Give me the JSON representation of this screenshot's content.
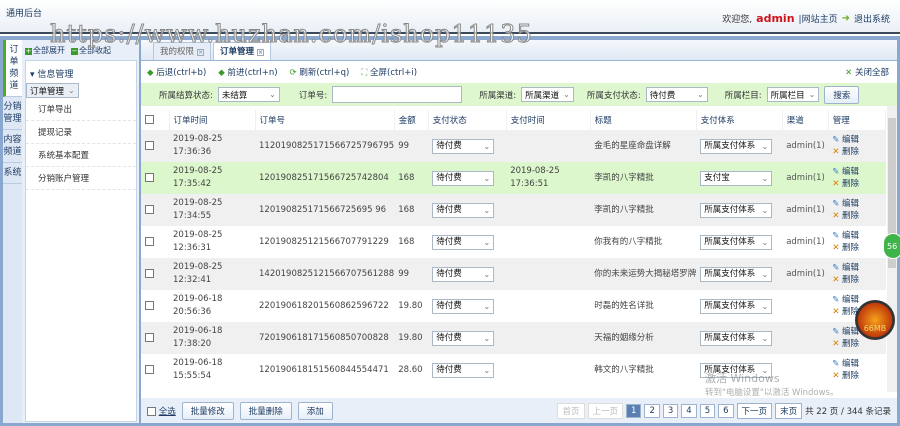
{
  "header": {
    "title": "通用后台",
    "welcome": "欢迎您,",
    "user": "admin",
    "site_home": "|网站主页",
    "logout": "退出系统"
  },
  "vtabs": [
    "订单频道",
    "分销管理",
    "内容频道",
    "系统"
  ],
  "left": {
    "expand_all": "全部展开",
    "collapse_all": "全部收起",
    "group": "信息管理",
    "items": [
      "订单管理",
      "订单导出",
      "提现记录",
      "系统基本配置",
      "分销账户管理"
    ]
  },
  "tabs": [
    "我的权限",
    "订单管理"
  ],
  "toolbar": {
    "back": "后退(ctrl+b)",
    "forward": "前进(ctrl+n)",
    "refresh": "刷新(ctrl+q)",
    "fullscreen": "全屏(ctrl+i)",
    "close_all": "关闭全部"
  },
  "filter": {
    "settle_label": "所属结算状态:",
    "settle_value": "未结算",
    "order_label": "订单号:",
    "order_value": "",
    "channel_label": "所属渠道:",
    "channel_value": "所属渠道",
    "pay_label": "所属支付状态:",
    "pay_value": "待付费",
    "column_label": "所属栏目:",
    "column_value": "所属栏目",
    "search": "搜索"
  },
  "table": {
    "headers": [
      "订单时间",
      "订单号",
      "金额",
      "支付状态",
      "支付时间",
      "标题",
      "支付体系",
      "渠道",
      "管理"
    ],
    "rows": [
      {
        "date": "2019-08-25",
        "time": "17:36:36",
        "order": "1120190825171566725796795",
        "amount": "99",
        "status": "待付费",
        "pay_date": "",
        "pay_time": "",
        "title": "金毛的星座命盘详解",
        "system": "所属支付体系",
        "channel": "admin(1)"
      },
      {
        "date": "2019-08-25",
        "time": "17:35:42",
        "order": "120190825171566725742804",
        "amount": "168",
        "status": "待付费",
        "pay_date": "2019-08-25",
        "pay_time": "17:36:51",
        "title": "李凯的八字精批",
        "system": "支付宝",
        "channel": "admin(1)"
      },
      {
        "date": "2019-08-25",
        "time": "17:34:55",
        "order": "120190825171566725695 96",
        "amount": "168",
        "status": "待付费",
        "pay_date": "",
        "pay_time": "",
        "title": "李凯的八字精批",
        "system": "所属支付体系",
        "channel": "admin(1)"
      },
      {
        "date": "2019-08-25",
        "time": "12:36:31",
        "order": "120190825121566707791229",
        "amount": "168",
        "status": "待付费",
        "pay_date": "",
        "pay_time": "",
        "title": "你我有的八字精批",
        "system": "所属支付体系",
        "channel": "admin(1)"
      },
      {
        "date": "2019-08-25",
        "time": "12:32:41",
        "order": "1420190825121566707561288",
        "amount": "99",
        "status": "待付费",
        "pay_date": "",
        "pay_time": "",
        "title": "你的未来运势大揭秘塔罗牌",
        "system": "所属支付体系",
        "channel": "admin(1)"
      },
      {
        "date": "2019-06-18",
        "time": "20:56:36",
        "order": "220190618201560862596722",
        "amount": "19.80",
        "status": "待付费",
        "pay_date": "",
        "pay_time": "",
        "title": "时磊的姓名详批",
        "system": "所属支付体系",
        "channel": ""
      },
      {
        "date": "2019-06-18",
        "time": "17:38:20",
        "order": "720190618171560850700828",
        "amount": "19.80",
        "status": "待付费",
        "pay_date": "",
        "pay_time": "",
        "title": "天福的姻缘分析",
        "system": "所属支付体系",
        "channel": ""
      },
      {
        "date": "2019-06-18",
        "time": "15:55:54",
        "order": "120190618151560844554471",
        "amount": "28.60",
        "status": "待付费",
        "pay_date": "",
        "pay_time": "",
        "title": "韩文的八字精批",
        "system": "所属支付体系",
        "channel": ""
      }
    ],
    "edit": "编辑",
    "delete": "删除"
  },
  "footer": {
    "select_all": "全选",
    "batch_edit": "批量修改",
    "batch_delete": "批量删除",
    "add": "添加",
    "first": "首页",
    "prev": "上一页",
    "pages": [
      "1",
      "2",
      "3",
      "4",
      "5",
      "6"
    ],
    "next": "下一页",
    "last": "末页",
    "summary": "共 22 页 / 344 条记录"
  },
  "overlays": {
    "watermark": "https://www.huzhan.com/ishop11135",
    "badge_green": "56",
    "badge_mem": "66MB",
    "win_activate": "激活 Windows",
    "win_hint": "转到\"电脑设置\"以激活 Windows。"
  }
}
